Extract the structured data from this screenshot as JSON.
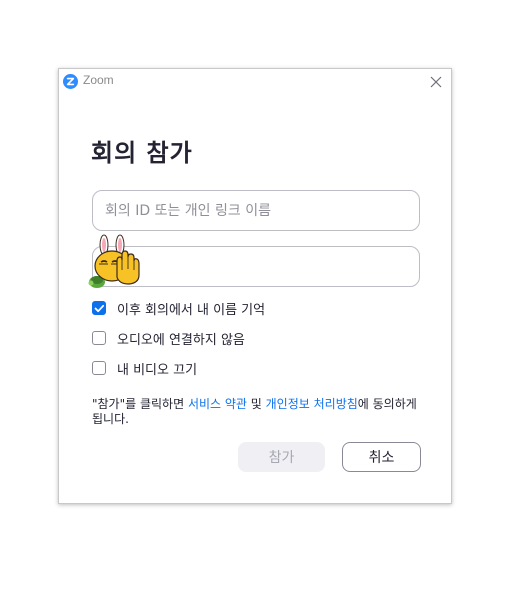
{
  "window": {
    "app_title": "Zoom",
    "heading": "회의 참가"
  },
  "form": {
    "meeting_id_placeholder": "회의 ID 또는 개인 링크 이름",
    "meeting_id_value": "",
    "name_value": ""
  },
  "options": [
    {
      "label": "이후 회의에서 내 이름 기억",
      "checked": true
    },
    {
      "label": "오디오에 연결하지 않음",
      "checked": false
    },
    {
      "label": "내 비디오 끄기",
      "checked": false
    }
  ],
  "terms": {
    "prefix": "\"참가\"를 클릭하면 ",
    "service_link": "서비스 약관",
    "and": " 및 ",
    "privacy_link": "개인정보 처리방침",
    "suffix": "에 동의하게 됩니다."
  },
  "buttons": {
    "join": "참가",
    "cancel": "취소"
  },
  "colors": {
    "accent": "#0e71eb",
    "logo": "#2d8cff",
    "text": "#232333"
  }
}
